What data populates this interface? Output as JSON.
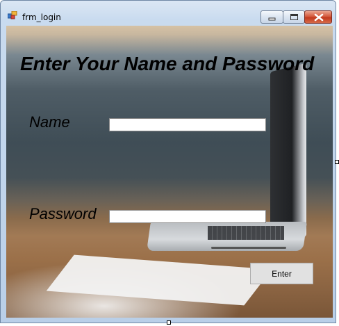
{
  "window": {
    "title": "frm_login",
    "icon": "app-form-icon",
    "controls": {
      "minimize_icon": "minimize-icon",
      "maximize_icon": "maximize-icon",
      "close_icon": "close-icon"
    }
  },
  "form": {
    "heading": "Enter Your Name and Password",
    "name_label": "Name",
    "name_value": "",
    "password_label": "Password",
    "password_value": "",
    "enter_label": "Enter"
  },
  "colors": {
    "close_button": "#c2391d",
    "button_face": "#e1e1e1"
  }
}
